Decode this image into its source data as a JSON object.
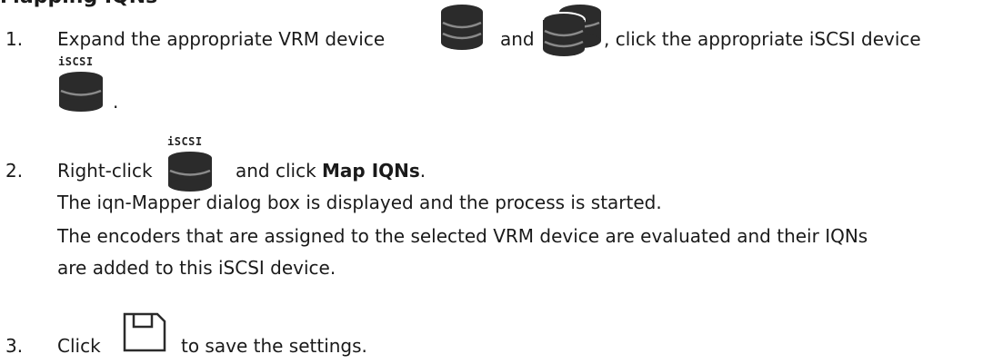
{
  "heading": "Mapping IQNs",
  "steps": [
    {
      "number": "1.",
      "before_icons": "Expand the appropriate VRM device",
      "between_icons": "and",
      "after_icons": ", click the appropriate iSCSI device",
      "end": "."
    },
    {
      "number": "2.",
      "before_icon": "Right-click",
      "after_icon": "and click",
      "bold": "Map IQNs",
      "end": ".",
      "line2": "The iqn-Mapper dialog box is displayed and the process is started.",
      "line3": "The encoders that are assigned to the selected VRM device are evaluated and their IQNs",
      "line4": "are added to this iSCSI device."
    },
    {
      "number": "3.",
      "before_icon": "Click",
      "after_icon": "to save the settings."
    }
  ],
  "icons": {
    "vrm_device": "database-icon",
    "vrm_devices": "database-stack-icon",
    "iscsi_device": "iscsi-device-icon",
    "save": "save-icon"
  },
  "iscsi_label": "iSCSI",
  "colors": {
    "icon_dark": "#2b2b2b",
    "icon_stripe": "#8a8a8a",
    "text": "#1a1a1a"
  }
}
